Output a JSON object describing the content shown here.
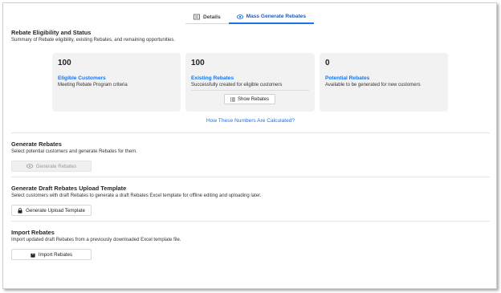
{
  "tabs": [
    {
      "label": "Details",
      "icon": "details-icon",
      "active": false
    },
    {
      "label": "Mass Generate Rebates",
      "icon": "eye-icon",
      "active": true
    }
  ],
  "eligibility": {
    "title": "Rebate Eligibility and Status",
    "subtitle": "Summary of Rebate eligibility, existing Rebates, and remaining opportunities."
  },
  "cards": [
    {
      "count": "100",
      "title": "Eligible Customers",
      "description": "Meeting Rebate Program criteria"
    },
    {
      "count": "100",
      "title": "Existing Rebates",
      "description": "Successfully created for eligible customers",
      "button": "Show Rebates"
    },
    {
      "count": "0",
      "title": "Potential Rebates",
      "description": "Available to be generated for new customers"
    }
  ],
  "how_link": "How These Numbers Are Calculated?",
  "generate": {
    "title": "Generate Rebates",
    "subtitle": "Select potential customers and generate Rebates for them.",
    "button": "Generate Rebates",
    "disabled": true
  },
  "template": {
    "title": "Generate Draft Rebates Upload Template",
    "subtitle": "Select customers with draft Rebates to generate a draft Rebates Excel template for offline editing and uploading later.",
    "button": "Generate Upload Template"
  },
  "import": {
    "title": "Import Rebates",
    "subtitle": "Import updated draft Rebates from a previously downloaded Excel template file.",
    "button": "Import Rebates"
  },
  "colors": {
    "accent": "#1a73e8",
    "card_bg": "#f2f2f2"
  }
}
